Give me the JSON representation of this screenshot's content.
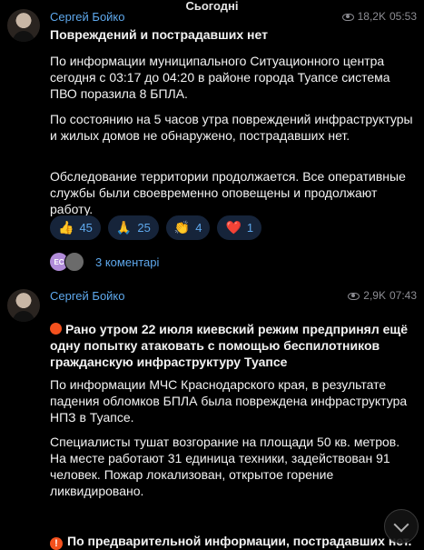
{
  "date_label": "Сьогодні",
  "posts": [
    {
      "author": "Сергей Бойко",
      "views": "18,2K",
      "time": "05:53",
      "headline": "Повреждений и пострадавших нет",
      "paragraphs": [
        "По информации муниципального Ситуационного центра сегодня с 03:17 до 04:20 в районе города Туапсе система ПВО поразила 8 БПЛА.",
        "По состоянию на 5 часов утра повреждений инфраструктуры и жилых домов не обнаружено, пострадавших нет.",
        "Обследование территории продолжается. Все оперативные службы были своевременно оповещены и продолжают работу."
      ],
      "reactions": [
        {
          "emoji": "👍",
          "count": "45"
        },
        {
          "emoji": "🙏",
          "count": "25"
        },
        {
          "emoji": "👏",
          "count": "4"
        },
        {
          "emoji": "❤️",
          "count": "1"
        }
      ],
      "comments": {
        "avatar_initials": "EC",
        "label": "3 коментарі"
      }
    },
    {
      "author": "Сергей Бойко",
      "views": "2,9K",
      "time": "07:43",
      "headline": "Рано утром 22 июля киевский режим предпринял ещё одну попытку атаковать с помощью беспилотников гражданскую инфраструктуру Туапсе",
      "paragraphs": [
        "По информации МЧС Краснодарского края, в результате падения обломков БПЛА была повреждена инфраструктура НПЗ в Туапсе.",
        "Специалисты тушат возгорание на площади 50 кв. метров.\nНа месте работают 31 единица техники, задействован 91 человек. Пожар  локализован, открытое горение ликвидировано."
      ],
      "warning": "По предварительной информации, пострадавших нет."
    }
  ],
  "icons": {
    "views": "eye-icon",
    "scroll": "chevron-down-icon",
    "headline_marker": "red-circle-icon",
    "warning_marker": "exclamation-icon"
  },
  "colors": {
    "accent": "#5ea8ec",
    "meta": "#8d8d93",
    "reaction_bg": "#16243a",
    "marker": "#f4511e"
  }
}
